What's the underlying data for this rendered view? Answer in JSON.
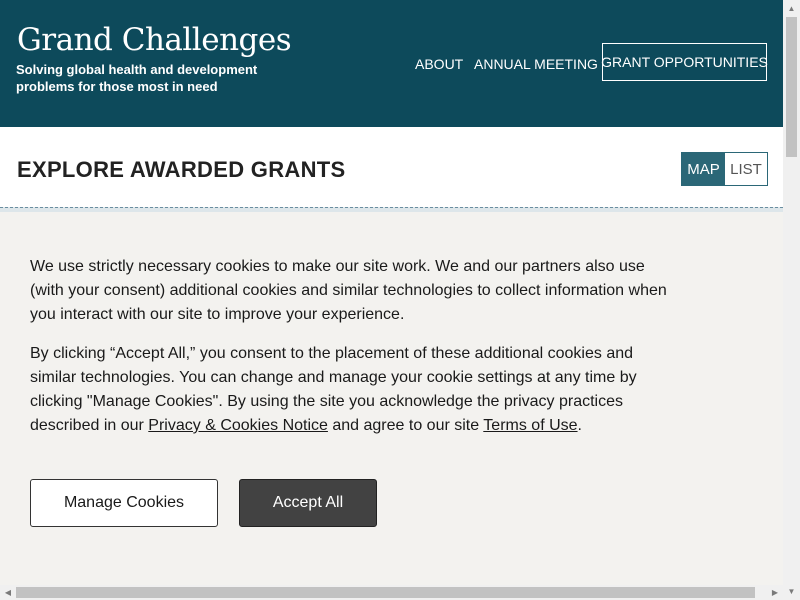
{
  "header": {
    "title": "Grand Challenges",
    "tagline": "Solving global health and development problems for those most in need"
  },
  "nav": {
    "about": "ABOUT",
    "annual_meeting": "ANNUAL MEETING",
    "grant_opportunities": "GRANT OPPORTUNITIES"
  },
  "explore": {
    "title": "EXPLORE AWARDED GRANTS",
    "map_label": "MAP",
    "list_label": "LIST"
  },
  "cookie": {
    "p1": "We use strictly necessary cookies to make our site work. We and our partners also use (with your consent) additional cookies and similar technologies to collect information when you interact with our site to improve your experience.",
    "p2_start": "By clicking “Accept All,” you consent to the placement of these additional cookies and similar technologies. You can change and manage your cookie settings at any time by clicking \"Manage Cookies\". By using the site you acknowledge the privacy practices described in our ",
    "privacy_link": "Privacy & Cookies Notice",
    "p2_middle": " and agree to our site ",
    "terms_link": "Terms of Use",
    "p2_end": ".",
    "manage_label": "Manage Cookies",
    "accept_label": "Accept All"
  },
  "colors": {
    "header_bg": "#0d4a5b",
    "toggle_active": "#2b6777",
    "banner_bg": "#f3f2ef",
    "accept_bg": "#424242"
  },
  "icons": {
    "scroll_up": "▲",
    "scroll_down": "▼",
    "scroll_left": "◀",
    "scroll_right": "▶"
  }
}
